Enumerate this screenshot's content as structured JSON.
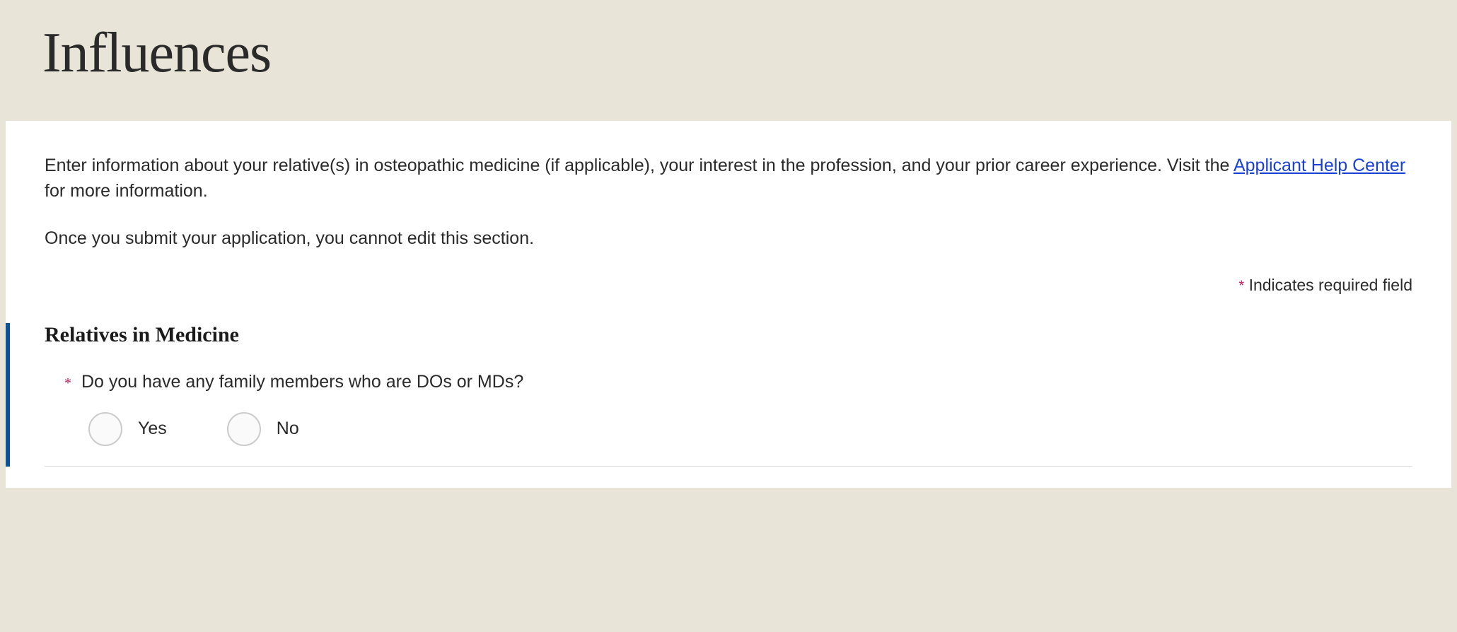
{
  "header": {
    "title": "Influences"
  },
  "intro": {
    "text_before_link": "Enter information about your relative(s) in osteopathic medicine (if applicable), your interest in the profession, and your prior career experience. Visit the ",
    "link_text": "Applicant Help Center",
    "text_after_link": " for more information."
  },
  "submit_note": "Once you submit your application, you cannot edit this section.",
  "required_note": {
    "star": "*",
    "text": " Indicates required field"
  },
  "section": {
    "heading": "Relatives in Medicine",
    "question": {
      "star": "*",
      "text": "Do you have any family members who are DOs or MDs?"
    },
    "options": {
      "yes": "Yes",
      "no": "No"
    }
  }
}
